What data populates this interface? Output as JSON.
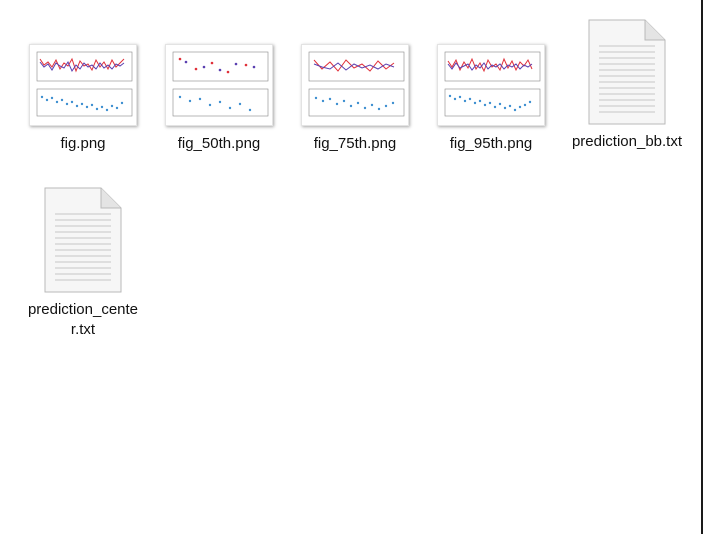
{
  "files": [
    {
      "name": "fig.png",
      "type": "image",
      "variant": "many"
    },
    {
      "name": "fig_50th.png",
      "type": "image",
      "variant": "sparse"
    },
    {
      "name": "fig_75th.png",
      "type": "image",
      "variant": "mid"
    },
    {
      "name": "fig_95th.png",
      "type": "image",
      "variant": "many"
    },
    {
      "name": "prediction_bb.txt",
      "type": "text"
    },
    {
      "name": "prediction_center.txt",
      "type": "text"
    }
  ],
  "icons": {
    "image": "image-thumbnail-icon",
    "text": "text-document-icon"
  },
  "colors": {
    "background": "#ffffff",
    "label": "#111111",
    "red_series": "#e0303a",
    "blue_series": "#5a3fb0",
    "cyan_series": "#3d8fd0"
  }
}
